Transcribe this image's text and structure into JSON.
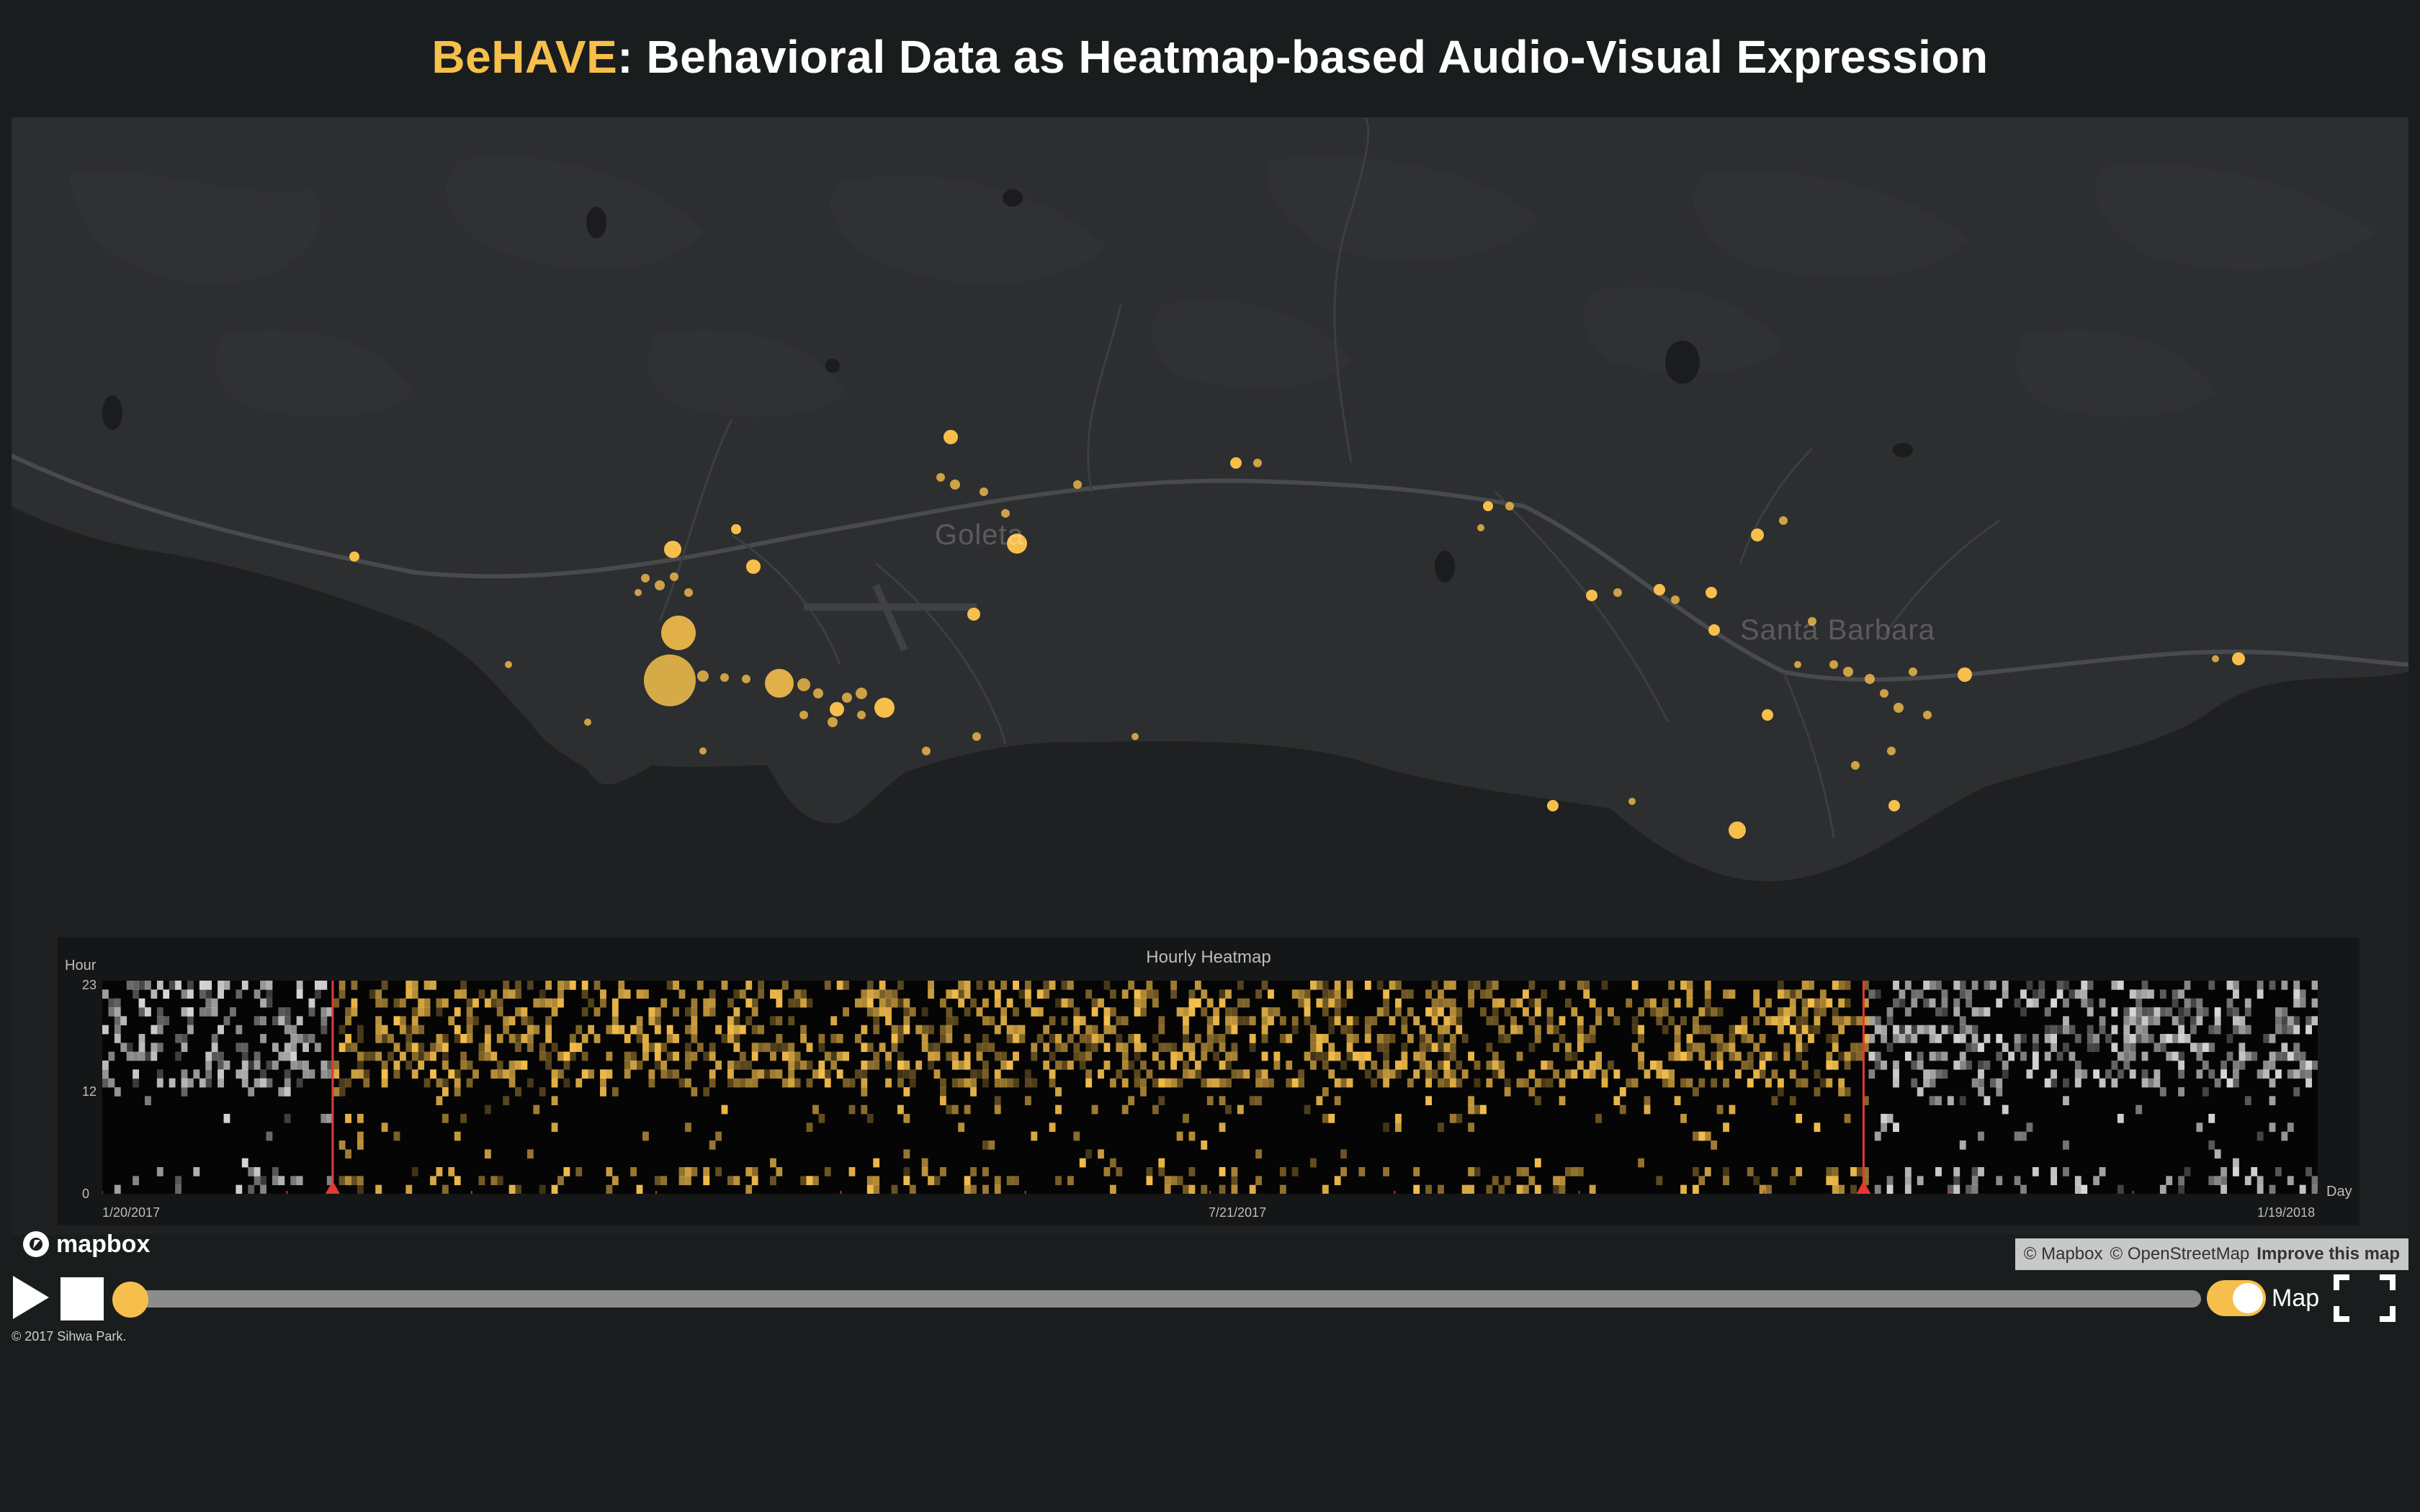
{
  "header": {
    "title_accent": "BeHAVE",
    "title_rest": ": Behavioral Data as Heatmap-based Audio-Visual Expression"
  },
  "map": {
    "labels": {
      "goleta": "Goleta",
      "santa_barbara": "Santa Barbara"
    },
    "point_color": "#f6bf4c"
  },
  "heatmap": {
    "title": "Hourly Heatmap",
    "y_axis_label": "Hour",
    "x_axis_label": "Day",
    "y_ticks": [
      "23",
      "12",
      "0"
    ],
    "x_ticks": [
      "1/20/2017",
      "7/21/2017",
      "1/19/2018"
    ],
    "colors": {
      "active": "#f6bf4c",
      "inactive": "#d9d9d9",
      "marker": "#e23a32"
    },
    "selection": {
      "start_fraction": 0.104,
      "end_fraction": 0.795
    }
  },
  "attribution": {
    "mapbox": "© Mapbox",
    "osm": "© OpenStreetMap",
    "improve": "Improve this map"
  },
  "logo": {
    "text": "mapbox"
  },
  "controls": {
    "play_icon": "play-icon",
    "stop_icon": "stop-icon",
    "slider_progress": 0.0,
    "map_toggle_label": "Map",
    "map_toggle_on": true,
    "fullscreen_icon": "fullscreen-icon"
  },
  "footer": {
    "copyright": "© 2017 Sihwa Park."
  }
}
